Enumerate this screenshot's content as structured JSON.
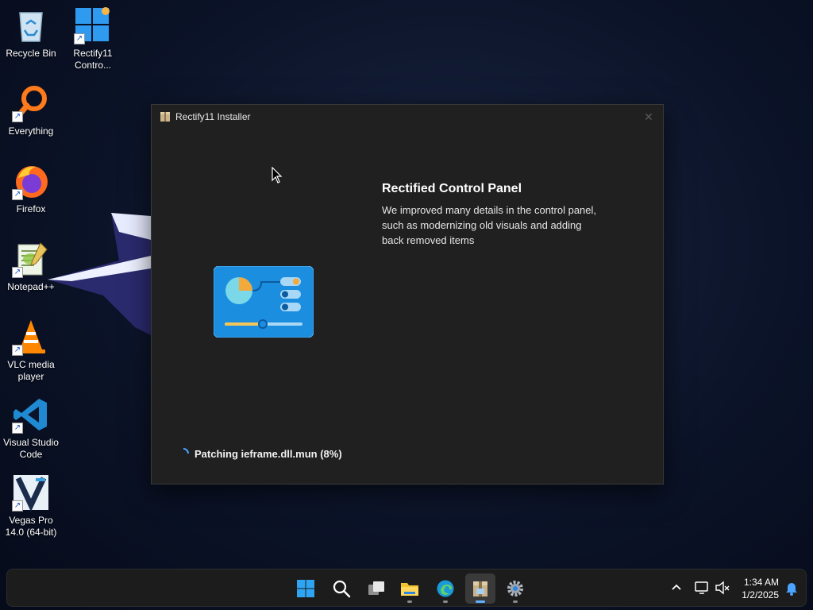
{
  "desktop": {
    "icons": [
      {
        "label": "Recycle Bin",
        "icon": "recycle-bin-icon"
      },
      {
        "label": "Rectify11 Contro...",
        "icon": "control-panel-icon"
      },
      {
        "label": "Everything",
        "icon": "everything-search-icon"
      },
      {
        "label": "Firefox",
        "icon": "firefox-icon"
      },
      {
        "label": "Notepad++",
        "icon": "notepad-plus-plus-icon"
      },
      {
        "label": "VLC media player",
        "icon": "vlc-icon"
      },
      {
        "label": "Visual Studio Code",
        "icon": "vscode-icon"
      },
      {
        "label": "Vegas Pro 14.0 (64-bit)",
        "icon": "vegas-pro-icon"
      }
    ]
  },
  "window": {
    "title": "Rectify11 Installer",
    "close_glyph": "✕",
    "feature": {
      "title": "Rectified Control Panel",
      "description": "We improved many details in the control panel, such as modernizing old visuals and adding back removed items"
    },
    "status": "Patching ieframe.dll.mun (8%)"
  },
  "taskbar": {
    "buttons": [
      {
        "name": "start",
        "icon": "windows-start-icon"
      },
      {
        "name": "search",
        "icon": "search-icon"
      },
      {
        "name": "task-view",
        "icon": "task-view-icon"
      },
      {
        "name": "file-explorer",
        "icon": "folder-icon"
      },
      {
        "name": "edge",
        "icon": "edge-icon"
      },
      {
        "name": "rectify11-installer",
        "icon": "installer-package-icon"
      },
      {
        "name": "settings",
        "icon": "gear-icon"
      }
    ],
    "clock": {
      "time": "1:34 AM",
      "date": "1/2/2025"
    }
  },
  "colors": {
    "accent": "#0078d4",
    "window_bg": "#202020",
    "taskbar_bg": "#1c1c1c"
  }
}
